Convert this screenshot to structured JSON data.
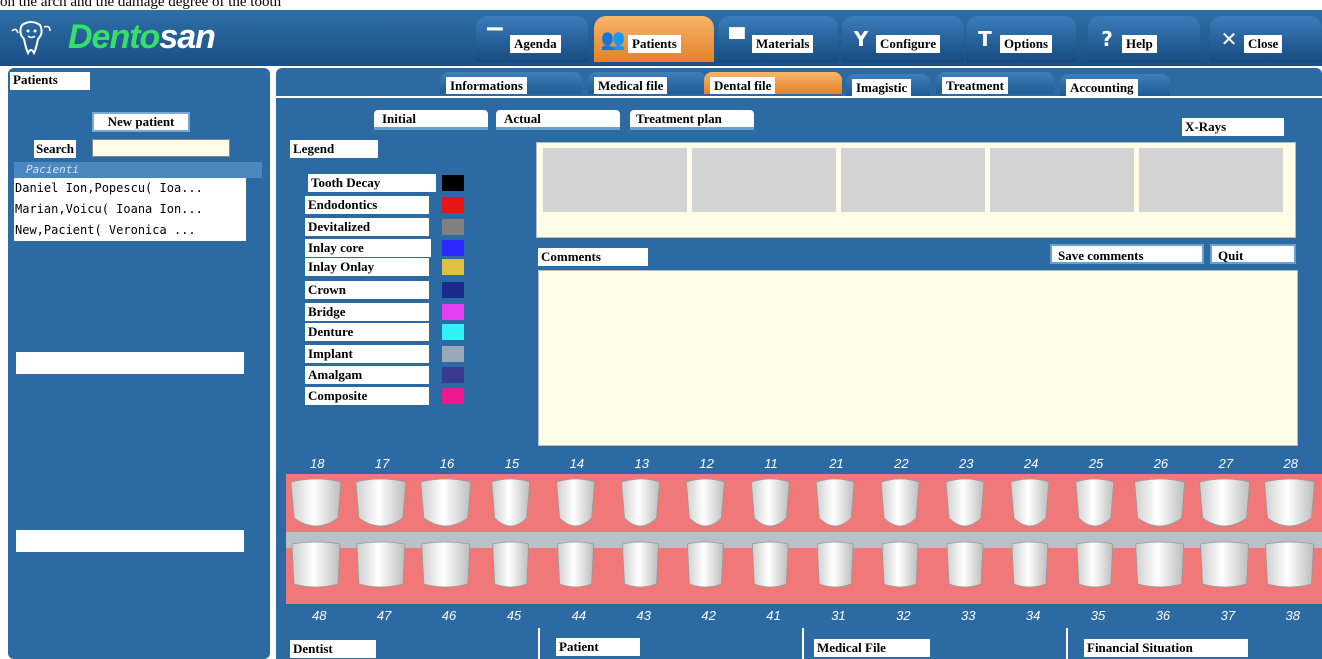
{
  "caption": "on the arch and the damage degree of the tooth",
  "app": {
    "logo_prefix": "Dento",
    "logo_suffix": "san"
  },
  "nav": [
    {
      "label": "Agenda",
      "icon": "agenda-icon"
    },
    {
      "label": "Patients",
      "icon": "patients-icon"
    },
    {
      "label": "Materials",
      "icon": "materials-icon"
    },
    {
      "label": "Configure",
      "icon": "configure-icon"
    },
    {
      "label": "Options",
      "icon": "options-icon"
    },
    {
      "label": "Help",
      "icon": "help-icon"
    },
    {
      "label": "Close",
      "icon": "close-icon"
    }
  ],
  "left": {
    "title": "Patients",
    "new_patient": "New patient",
    "search_label": "Search",
    "search_value": "",
    "list_header": "Pacienti",
    "patients": [
      "Daniel Ion,Popescu( Ioa...",
      "Marian,Voicu( Ioana Ion...",
      "New,Pacient( Veronica ..."
    ]
  },
  "subtabs": [
    "Informations",
    "Medical file",
    "Dental file",
    "Imagistic",
    "Treatment",
    "Accounting"
  ],
  "content_tabs": [
    "Initial",
    "Actual",
    "Treatment plan"
  ],
  "legend_title": "Legend",
  "legend": [
    {
      "label": "Tooth Decay",
      "color": "#000000"
    },
    {
      "label": "Endodontics",
      "color": "#e8141c"
    },
    {
      "label": "Devitalized",
      "color": "#808080"
    },
    {
      "label": "Inlay core",
      "color": "#2a2aff"
    },
    {
      "label": "Inlay Onlay",
      "color": "#e0c040"
    },
    {
      "label": "Crown",
      "color": "#1c2a8c"
    },
    {
      "label": "Bridge",
      "color": "#e040f0"
    },
    {
      "label": "Denture",
      "color": "#30f0f8"
    },
    {
      "label": "Implant",
      "color": "#98a8b8"
    },
    {
      "label": "Amalgam",
      "color": "#3a3a90"
    },
    {
      "label": "Composite",
      "color": "#f01890"
    }
  ],
  "xrays_label": "X-Rays",
  "comments_label": "Comments",
  "save_comments": "Save comments",
  "quit": "Quit",
  "upper_teeth": [
    "18",
    "17",
    "16",
    "15",
    "14",
    "13",
    "12",
    "11",
    "21",
    "22",
    "23",
    "24",
    "25",
    "26",
    "27",
    "28"
  ],
  "lower_teeth": [
    "48",
    "47",
    "46",
    "45",
    "44",
    "43",
    "42",
    "41",
    "31",
    "32",
    "33",
    "34",
    "35",
    "36",
    "37",
    "38"
  ],
  "bottom": [
    "Dentist",
    "Patient",
    "Medical File",
    "Financial Situation"
  ]
}
